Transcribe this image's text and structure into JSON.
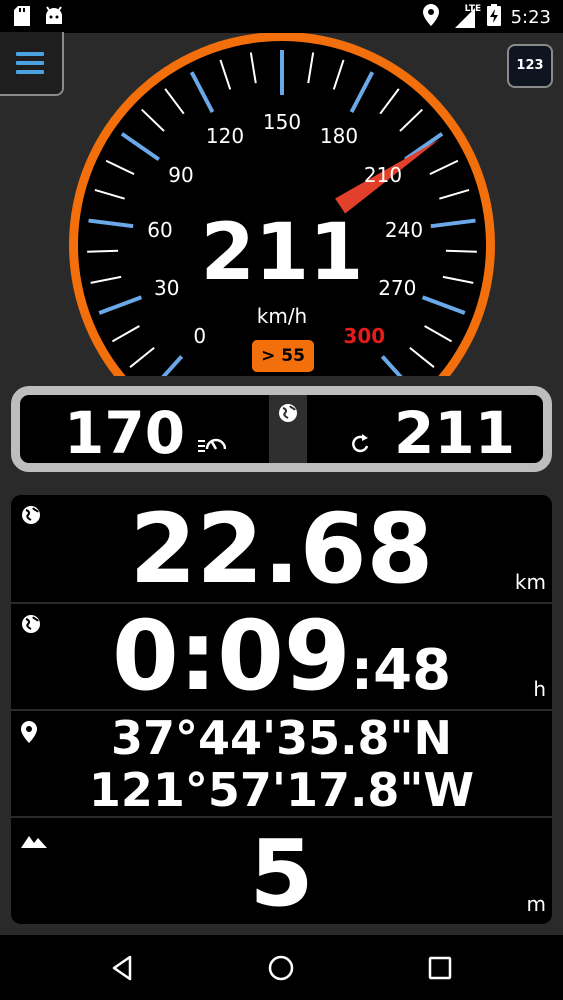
{
  "status_bar": {
    "time": "5:23",
    "network": "LTE",
    "left_icons": [
      "sd-card-icon",
      "android-icon"
    ],
    "right_icons": [
      "location-icon",
      "signal-icon",
      "battery-charging-icon"
    ]
  },
  "toolbar": {
    "menu_icon": "hamburger-menu-icon",
    "digital_mode_label": "123"
  },
  "speedometer": {
    "current_speed": "211",
    "unit": "km/h",
    "max_scale": 300,
    "scale_labels": [
      "0",
      "30",
      "60",
      "90",
      "120",
      "150",
      "180",
      "210",
      "240",
      "270",
      "300"
    ],
    "speed_limit_label": "> 55",
    "colors": {
      "ring": "#f26f0c",
      "major_tick": "#6aa8e8",
      "needle": "#e2402b",
      "limit_text": "#e31c1c"
    }
  },
  "averages": {
    "average_speed": "170",
    "average_icon": "average-speed-icon",
    "center_icon": "globe-icon",
    "max_speed": "211",
    "max_icon": "max-speed-icon"
  },
  "distance": {
    "value": "22.68",
    "unit": "km",
    "icon": "globe-icon"
  },
  "trip_time": {
    "main": "0:09",
    "seconds": ":48",
    "unit": "h",
    "icon": "globe-icon"
  },
  "position": {
    "icon": "location-pin-icon",
    "latitude": "37°44'35.8\"N",
    "longitude": "121°57'17.8\"W"
  },
  "altitude": {
    "value": "5",
    "unit": "m",
    "icon": "mountain-icon"
  },
  "nav_bar": {
    "back": "back-icon",
    "home": "home-icon",
    "recents": "recents-icon"
  }
}
